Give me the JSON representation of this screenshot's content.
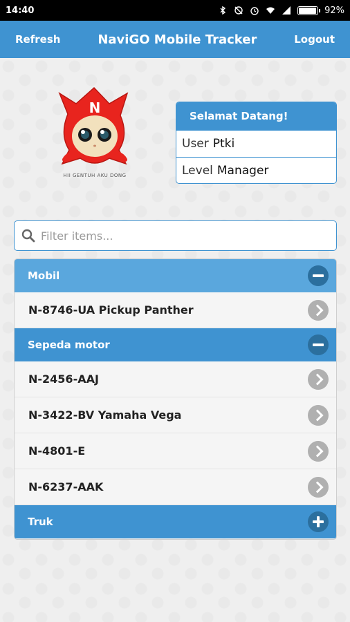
{
  "status_bar": {
    "time": "14:40",
    "battery": "92%",
    "icons": [
      "bluetooth-icon",
      "sync-off-icon",
      "alarm-icon",
      "wifi-icon",
      "signal-icon",
      "battery-icon"
    ]
  },
  "header": {
    "left_button": "Refresh",
    "title": "NaviGO Mobile Tracker",
    "right_button": "Logout"
  },
  "logo": {
    "letter": "N",
    "caption": "HII GENTUH AKU DONG"
  },
  "welcome": {
    "title": "Selamat Datang!",
    "user_label": "User",
    "user_value": "Ptki",
    "level_label": "Level",
    "level_value": "Manager"
  },
  "search": {
    "placeholder": "Filter items..."
  },
  "list": {
    "groups": [
      {
        "name": "Mobil",
        "state": "expanded",
        "items": [
          "N-8746-UA Pickup Panther"
        ]
      },
      {
        "name": "Sepeda motor",
        "state": "expanded",
        "items": [
          "N-2456-AAJ",
          "N-3422-BV Yamaha Vega",
          "N-4801-E",
          "N-6237-AAK"
        ]
      },
      {
        "name": "Truk",
        "state": "collapsed",
        "items": []
      }
    ]
  },
  "colors": {
    "primary": "#3f93d1",
    "primary_light": "#5aa7dd",
    "dark_button": "#2b6f9e",
    "chevron_button": "#b0b0b0",
    "logo_red": "#e8241e"
  }
}
